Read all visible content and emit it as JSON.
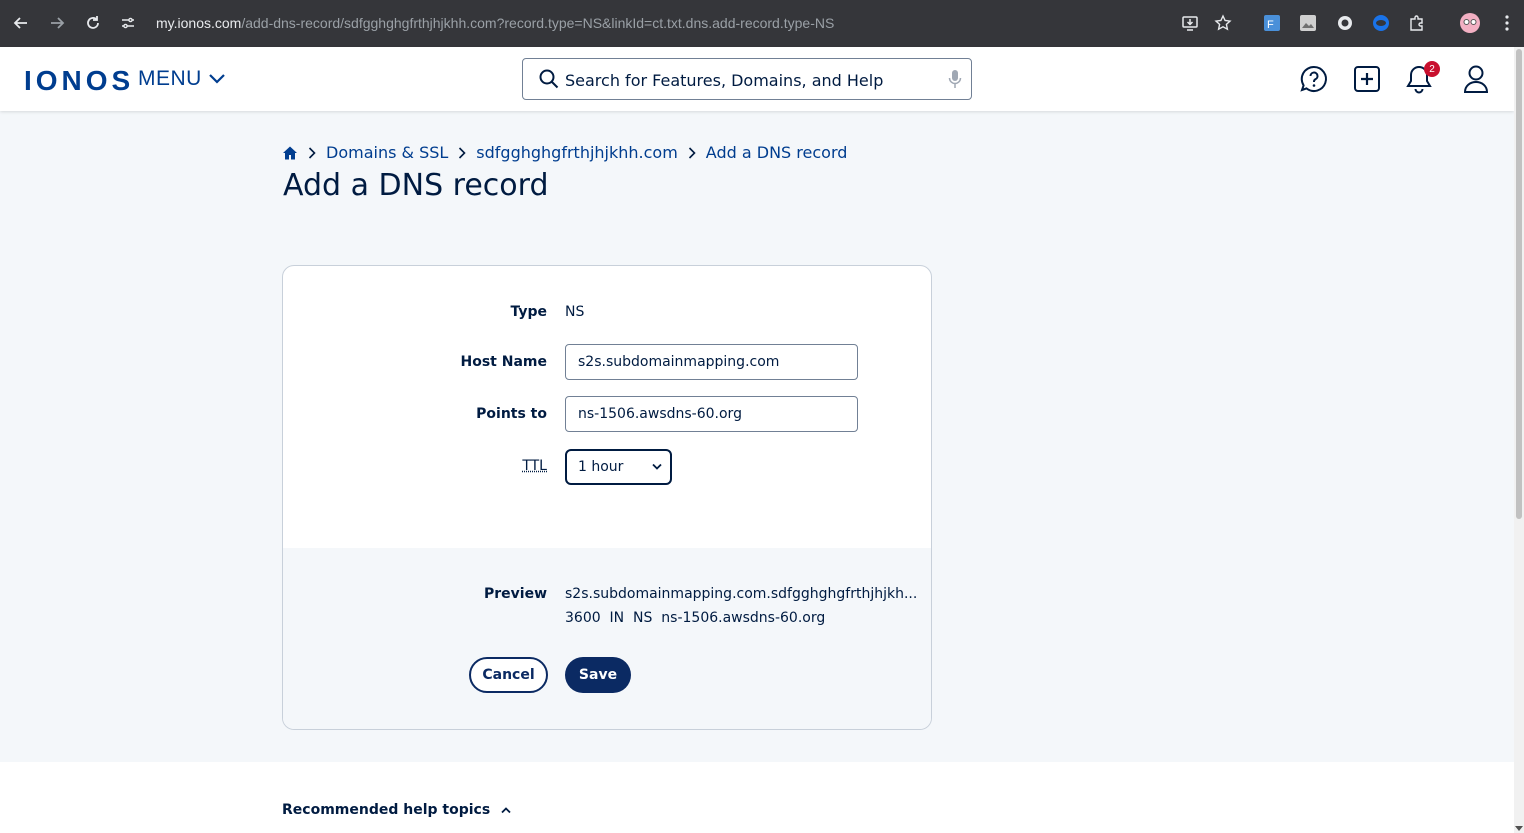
{
  "browser": {
    "url_host": "my.ionos.com",
    "url_path": "/add-dns-record/sdfgghghgfrthjhjkhh.com?record.type=NS&linkId=ct.txt.dns.add-record.type-NS"
  },
  "header": {
    "logo": "IONOS",
    "menu_label": "MENU",
    "search_placeholder": "Search for Features, Domains, and Help",
    "notification_count": "2"
  },
  "breadcrumb": {
    "items": [
      "Domains & SSL",
      "sdfgghghgfrthjhjkhh.com",
      "Add a DNS record"
    ]
  },
  "page_title": "Add a DNS record",
  "form": {
    "type_label": "Type",
    "type_value": "NS",
    "host_label": "Host Name",
    "host_value": "s2s.subdomainmapping.com",
    "points_label": "Points to",
    "points_value": "ns-1506.awsdns-60.org",
    "ttl_label": "TTL",
    "ttl_value": "1 hour",
    "preview_label": "Preview",
    "preview_line1": "s2s.subdomainmapping.com.sdfgghghgfrthjhjkh...",
    "preview_line2": "3600  IN  NS  ns-1506.awsdns-60.org",
    "cancel_label": "Cancel",
    "save_label": "Save"
  },
  "footer": {
    "help_topics": "Recommended help topics"
  },
  "colors": {
    "brand": "#003d8f",
    "primary_button": "#0b2a63",
    "badge": "#c8102e"
  }
}
